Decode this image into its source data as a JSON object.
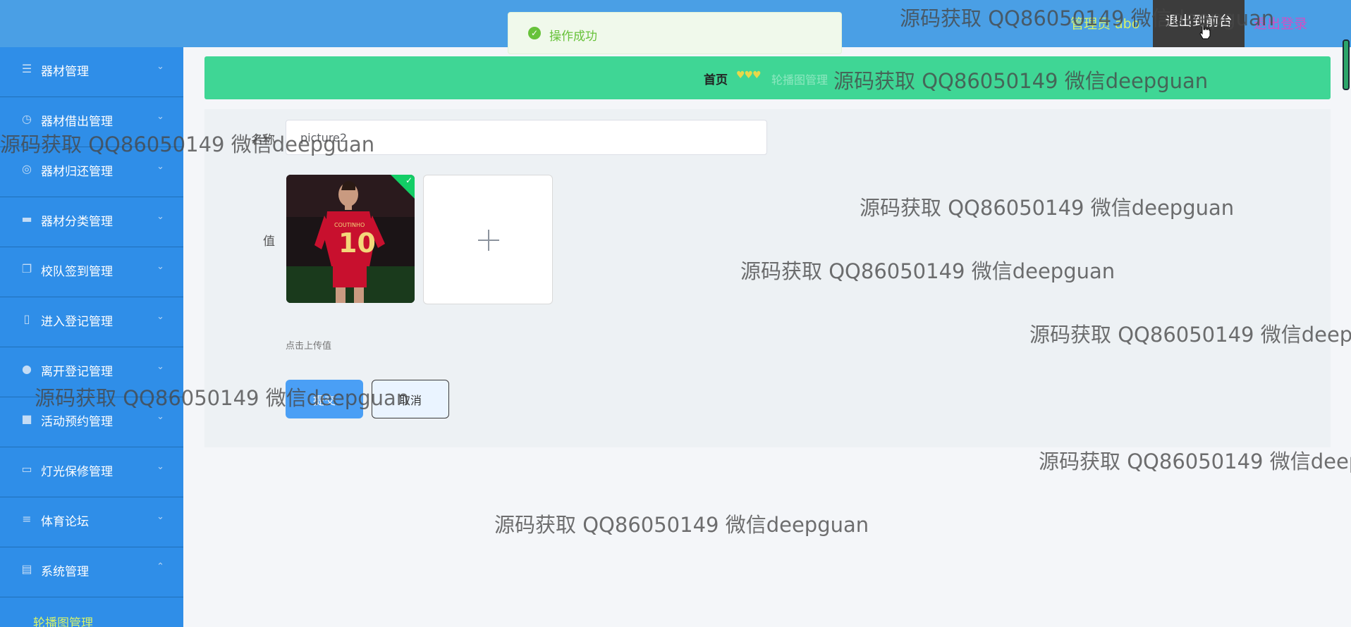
{
  "header": {
    "admin_label": "管理员 abo",
    "front_button": "退出到前台",
    "logout": "退出登录"
  },
  "toast": {
    "message": "操作成功"
  },
  "sidebar": {
    "items": [
      {
        "label": "器材管理",
        "icon": "list-icon"
      },
      {
        "label": "器材借出管理",
        "icon": "compass-icon"
      },
      {
        "label": "器材归还管理",
        "icon": "target-icon"
      },
      {
        "label": "器材分类管理",
        "icon": "monitor-icon"
      },
      {
        "label": "校队签到管理",
        "icon": "copy-icon"
      },
      {
        "label": "进入登记管理",
        "icon": "phone-icon"
      },
      {
        "label": "离开登记管理",
        "icon": "location-icon"
      },
      {
        "label": "活动预约管理",
        "icon": "briefcase-icon"
      },
      {
        "label": "灯光保修管理",
        "icon": "card-icon"
      },
      {
        "label": "体育论坛",
        "icon": "sliders-icon"
      },
      {
        "label": "系统管理",
        "icon": "clipboard-icon"
      }
    ],
    "sub_item": "轮播图管理"
  },
  "breadcrumb": {
    "home": "首页",
    "current": "轮播图管理"
  },
  "form": {
    "name_label": "名称",
    "name_value": "picture2",
    "value_label": "值",
    "upload_hint": "点击上传值",
    "submit": "提交",
    "cancel": "取消"
  },
  "watermark": "源码获取 QQ86050149 微信deepguan"
}
